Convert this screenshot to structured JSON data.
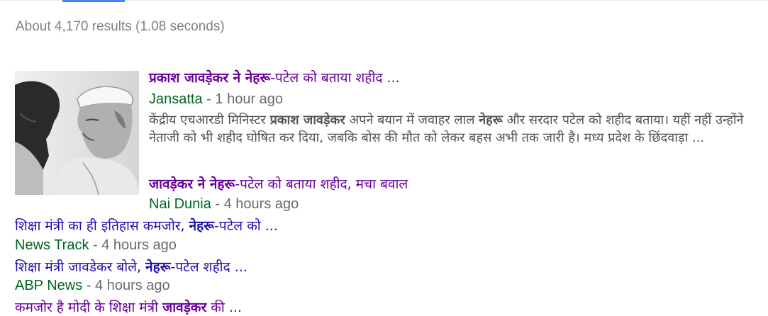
{
  "results_stats": "About 4,170 results (1.08 seconds)",
  "top_story": {
    "title_bold_1": "प्रकाश जावड़ेकर ने नेहरू",
    "title_rest": "-पटेल को बताया शहीद ...",
    "source": "Jansatta",
    "separator": " - ",
    "time": "1 hour ago",
    "snippet_1": "केंद्रीय एचआरडी मिनिस्टर ",
    "snippet_bold_1": "प्रकाश जावड़ेकर",
    "snippet_2": " अपने बयान में जवाहर लाल ",
    "snippet_bold_2": "नेहरू",
    "snippet_3": " और सरदार पटेल को शहीद बताया। यहीं नहीं उन्होंने नेताजी को भी शहीद घोषित कर दिया, जबकि बोस की मौत को लेकर बहस अभी तक जारी है। मध्य प्रदेश के छिंदवाड़ा ..."
  },
  "related": [
    {
      "bold": "जावड़ेकर ने नेहरू",
      "rest": "-पटेल को बताया शहीद, मचा बवाल",
      "source": "Nai Dunia",
      "separator": " - ",
      "time": "4 hours ago"
    },
    {
      "pre": "शिक्षा मंत्री का ही इतिहास कमजोर, ",
      "bold": "नेहरू",
      "rest": "-पटेल को ...",
      "source": "News Track",
      "separator": " - ",
      "time": "4 hours ago"
    },
    {
      "pre": "शिक्षा मंत्री जावडेकर बोले, ",
      "bold": "नेहरू",
      "rest": "-पटेल शहीद ...",
      "source": "ABP News",
      "separator": " - ",
      "time": "4 hours ago"
    },
    {
      "pre": "कमजोर है मोदी के शिक्षा मंत्री ",
      "bold": "जावड़ेकर",
      "rest": " की ..."
    }
  ],
  "colors": {
    "visited_link": "#660099",
    "link": "#1a0dab",
    "source_green": "#006621",
    "meta_gray": "#6a6a6a",
    "snippet_gray": "#545454",
    "tab_blue": "#4285f4"
  },
  "icons": {
    "thumbnail": "news-photo-thumbnail"
  }
}
